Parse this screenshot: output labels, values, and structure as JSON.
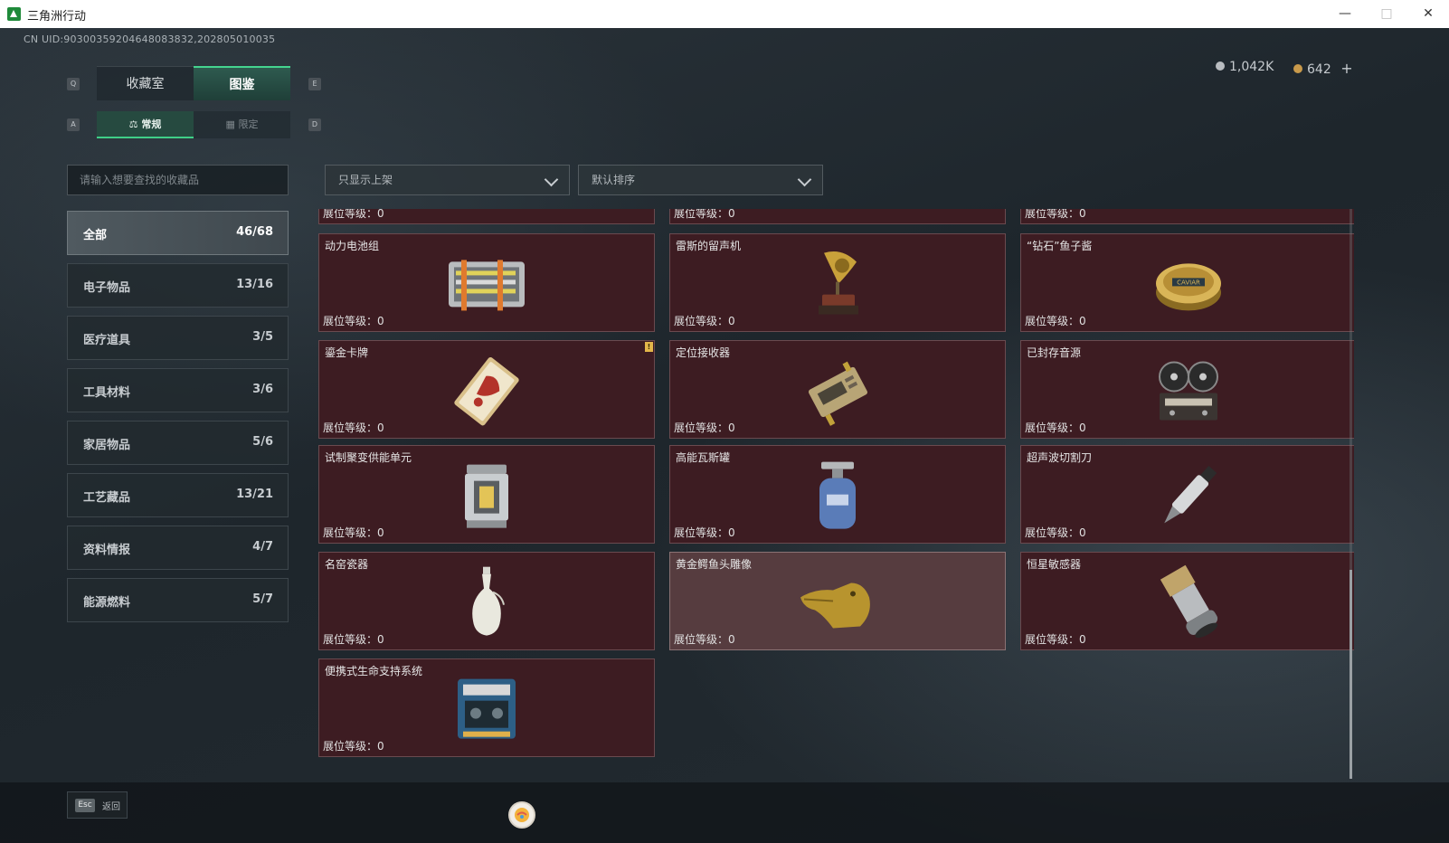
{
  "window": {
    "title": "三角洲行动"
  },
  "header": {
    "uid": "CN UID:90300359204648083832,202805010035",
    "silver": "1,042K",
    "gold": "642",
    "plus": "+"
  },
  "keys": {
    "q": "Q",
    "e": "E",
    "a": "A",
    "d": "D",
    "esc": "Esc"
  },
  "tabs": {
    "collection_room": "收藏室",
    "catalog": "图鉴"
  },
  "subtabs": {
    "regular": "常规",
    "limited": "限定"
  },
  "search": {
    "placeholder": "请输入想要查找的收藏品"
  },
  "filters": {
    "shelf": "只显示上架",
    "sort": "默认排序"
  },
  "categories": [
    {
      "label": "全部",
      "count": "46/68"
    },
    {
      "label": "电子物品",
      "count": "13/16"
    },
    {
      "label": "医疗道具",
      "count": "3/5"
    },
    {
      "label": "工具材料",
      "count": "3/6"
    },
    {
      "label": "家居物品",
      "count": "5/6"
    },
    {
      "label": "工艺藏品",
      "count": "13/21"
    },
    {
      "label": "资料情报",
      "count": "4/7"
    },
    {
      "label": "能源燃料",
      "count": "5/7"
    }
  ],
  "level_label": "展位等级：0",
  "items": [
    {
      "name": "动力电池组",
      "icon": "battery-pack-icon"
    },
    {
      "name": "雷斯的留声机",
      "icon": "gramophone-icon"
    },
    {
      "name": "“钻石”鱼子酱",
      "icon": "caviar-tin-icon"
    },
    {
      "name": "鎏金卡牌",
      "icon": "gilded-card-icon",
      "badge": "!"
    },
    {
      "name": "定位接收器",
      "icon": "gps-receiver-icon"
    },
    {
      "name": "已封存音源",
      "icon": "reel-recorder-icon"
    },
    {
      "name": "试制聚变供能单元",
      "icon": "fusion-unit-icon"
    },
    {
      "name": "高能瓦斯罐",
      "icon": "gas-canister-icon"
    },
    {
      "name": "超声波切割刀",
      "icon": "ultrasonic-knife-icon"
    },
    {
      "name": "名窑瓷器",
      "icon": "porcelain-vase-icon"
    },
    {
      "name": "黄金鳄鱼头雕像",
      "icon": "gold-crocodile-statue-icon"
    },
    {
      "name": "恒星敏感器",
      "icon": "star-sensor-icon"
    },
    {
      "name": "便携式生命支持系统",
      "icon": "life-support-icon"
    }
  ],
  "footer": {
    "back": "返回"
  },
  "colors": {
    "accent": "#44d48f",
    "card_bg": "#3d1c22",
    "card_highlight": "#563c3f"
  }
}
